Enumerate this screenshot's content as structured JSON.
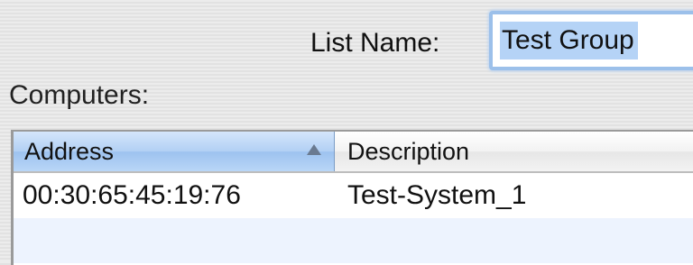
{
  "list_name": {
    "label": "List Name:",
    "value": "Test Group"
  },
  "computers": {
    "label": "Computers:",
    "columns": [
      "Address",
      "Description"
    ],
    "sorted_column": "Address",
    "sort_direction": "ascending",
    "sort_icon": "sort-ascending-icon",
    "rows": [
      {
        "address": "00:30:65:45:19:76",
        "description": "Test-System_1"
      }
    ]
  },
  "colors": {
    "selection": "#b5d3f6",
    "focus_ring": "#9cc0ea",
    "sorted_header": "#b2d0f4",
    "alt_row": "#edf3fe"
  }
}
